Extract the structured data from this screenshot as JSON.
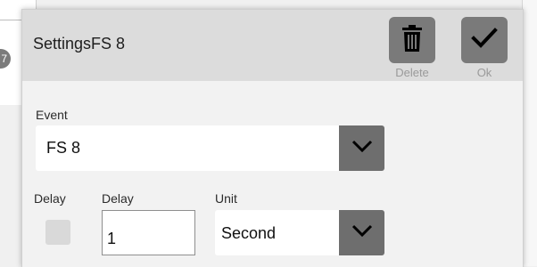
{
  "background": {
    "badge": "7"
  },
  "dialog": {
    "title": "SettingsFS 8",
    "actions": {
      "delete_label": "Delete",
      "ok_label": "Ok"
    }
  },
  "event": {
    "label": "Event",
    "value": "FS 8"
  },
  "delay": {
    "checkbox_label": "Delay",
    "input_label": "Delay",
    "value": "1"
  },
  "unit": {
    "label": "Unit",
    "value": "Second"
  },
  "colors": {
    "header_bg": "#dcdcdc",
    "button_bg": "#7a7a7a",
    "dropdown_arrow_bg": "#6e6e6e"
  }
}
